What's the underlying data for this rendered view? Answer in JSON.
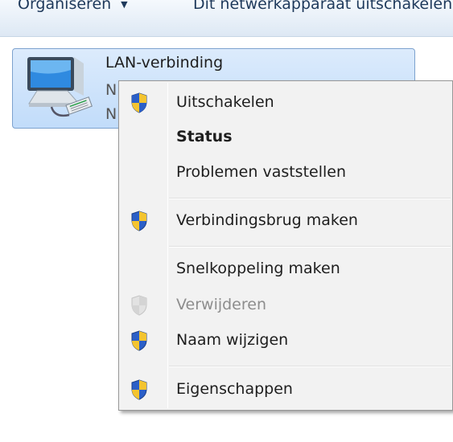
{
  "toolbar": {
    "organize_label": "Organiseren",
    "organize_chevron": "▼",
    "disable_label": "Dit netwerkapparaat uitschakelen"
  },
  "connection": {
    "name": "LAN-verbinding",
    "line1_visible": "N",
    "line2_visible": "N",
    "icon": "network-adapter-icon"
  },
  "context_menu": {
    "items": [
      {
        "label": "Uitschakelen",
        "icon": "uac-shield-icon",
        "bold": false,
        "enabled": true
      },
      {
        "label": "Status",
        "icon": null,
        "bold": true,
        "enabled": true
      },
      {
        "label": "Problemen vaststellen",
        "icon": null,
        "bold": false,
        "enabled": true
      },
      {
        "label": "Verbindingsbrug maken",
        "icon": "uac-shield-icon",
        "bold": false,
        "enabled": true
      },
      {
        "label": "Snelkoppeling maken",
        "icon": null,
        "bold": false,
        "enabled": true
      },
      {
        "label": "Verwijderen",
        "icon": "uac-shield-icon",
        "bold": false,
        "enabled": false
      },
      {
        "label": "Naam wijzigen",
        "icon": "uac-shield-icon",
        "bold": false,
        "enabled": true
      },
      {
        "label": "Eigenschappen",
        "icon": "uac-shield-icon",
        "bold": false,
        "enabled": true
      }
    ]
  },
  "colors": {
    "shield_blue": "#2b5fc7",
    "shield_yellow": "#f4c430",
    "selection_blue": "#c1dcfa",
    "menu_background": "#f2f2f2"
  }
}
